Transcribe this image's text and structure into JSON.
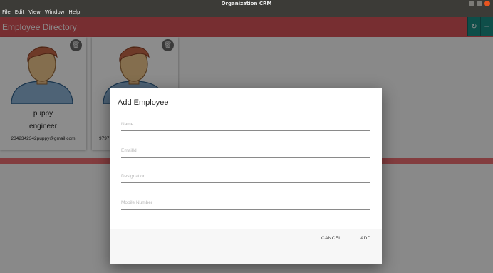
{
  "window": {
    "title": "Organization CRM"
  },
  "menu": [
    "File",
    "Edit",
    "View",
    "Window",
    "Help"
  ],
  "toolbar": {
    "title": "Employee Directory",
    "refresh_icon": "refresh-icon",
    "add_icon": "plus-icon"
  },
  "cards": [
    {
      "name": "puppy",
      "role": "engineer",
      "email": "2342342342puppy@gmail.com"
    },
    {
      "name": "",
      "role": "",
      "email": "9797"
    }
  ],
  "dialog": {
    "title": "Add Employee",
    "fields": {
      "name": {
        "placeholder": "Name",
        "value": ""
      },
      "email": {
        "placeholder": "EmailId",
        "value": ""
      },
      "designation": {
        "placeholder": "Designation",
        "value": ""
      },
      "mobile": {
        "placeholder": "Mobile Number",
        "value": ""
      }
    },
    "cancel_label": "CANCEL",
    "add_label": "ADD"
  },
  "colors": {
    "accent": "#d9545a",
    "teal": "#1a8e86",
    "titlebar": "#3c3b37"
  }
}
